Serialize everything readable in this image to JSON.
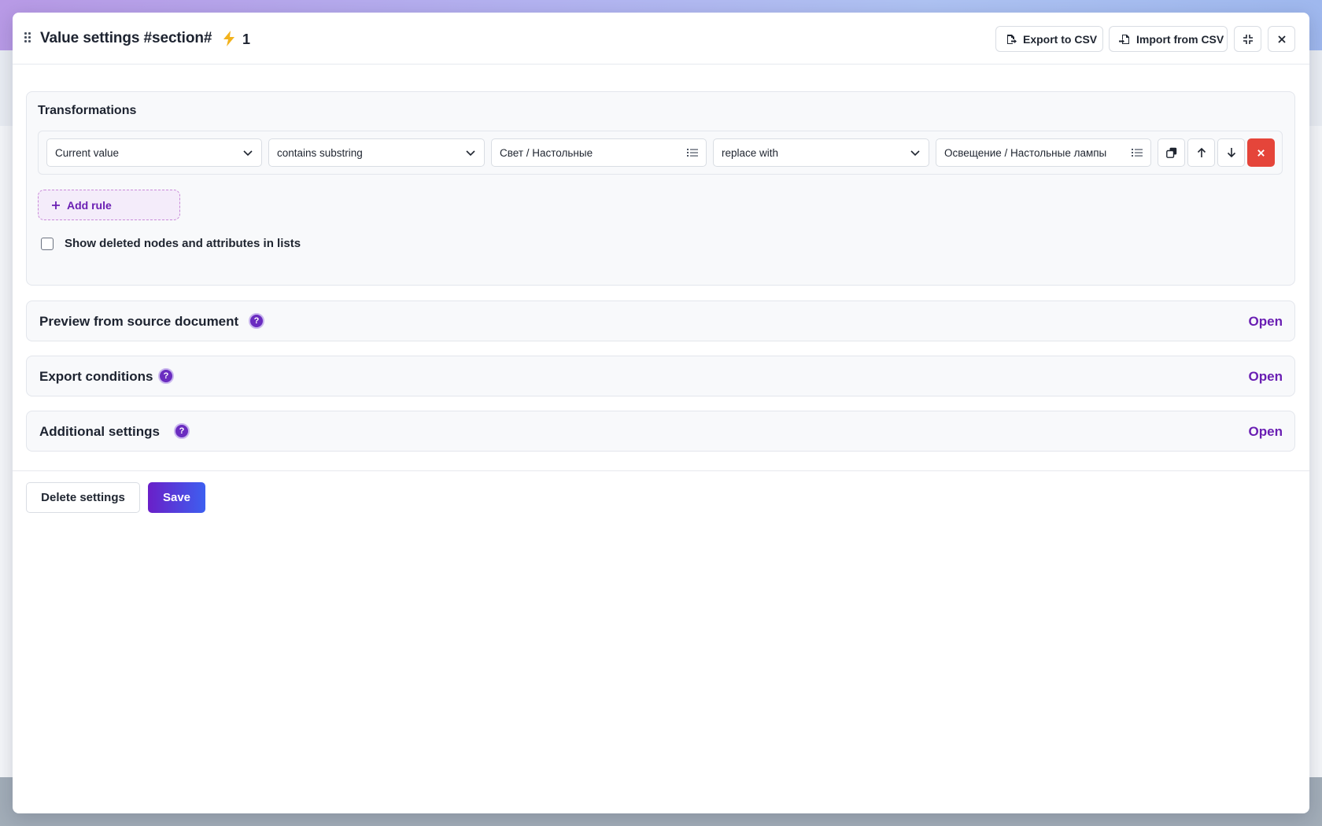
{
  "header": {
    "title": "Value settings #section#",
    "bolt_count": "1",
    "export_label": "Export to CSV",
    "import_label": "Import from CSV"
  },
  "transformations": {
    "title": "Transformations",
    "rule": {
      "source": "Current value",
      "operator": "contains substring",
      "search_value": "Свет / Настольные",
      "action": "replace with",
      "replace_value": "Освещение / Настольные лампы"
    },
    "add_rule_label": "Add rule",
    "show_deleted_label": "Show deleted nodes and attributes in lists",
    "show_deleted_checked": false
  },
  "sections": {
    "preview": {
      "title": "Preview from source document",
      "help": "?",
      "action": "Open"
    },
    "export_conditions": {
      "title": "Export conditions",
      "help": "?",
      "action": "Open"
    },
    "additional": {
      "title": "Additional settings",
      "help": "?",
      "action": "Open"
    }
  },
  "footer": {
    "delete_label": "Delete settings",
    "save_label": "Save"
  },
  "colors": {
    "accent": "#6a1fb3",
    "delete": "#e5453a",
    "bolt": "#f2b21c"
  }
}
